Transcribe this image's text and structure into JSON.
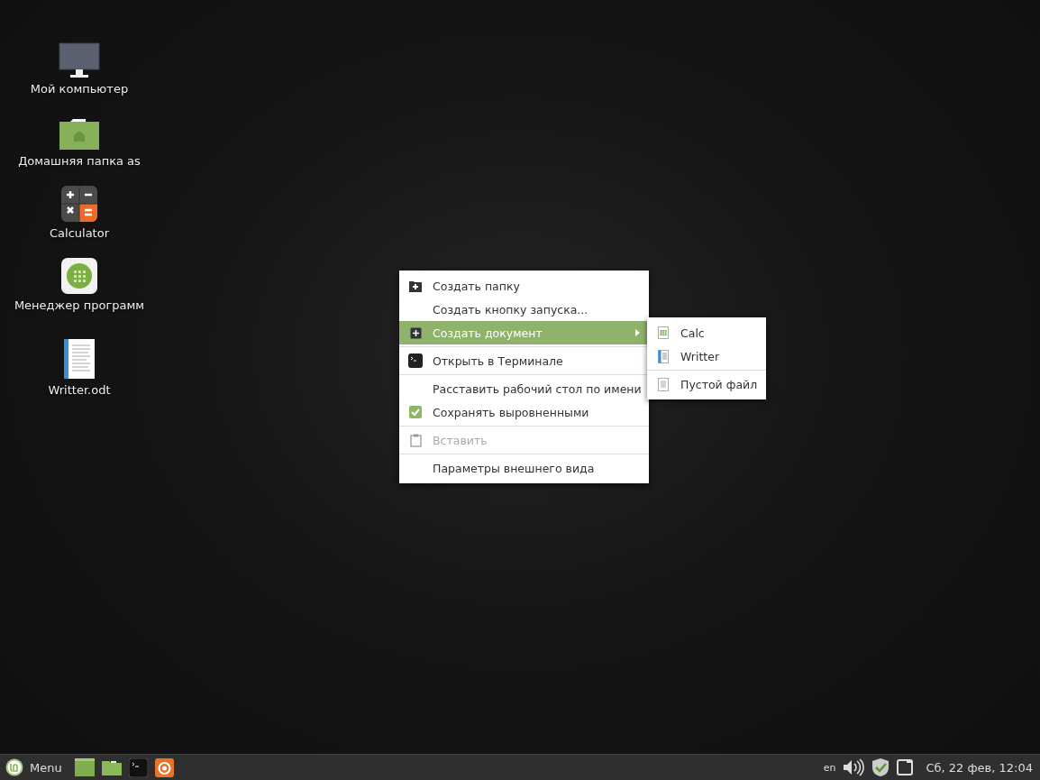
{
  "desktop_icons": [
    {
      "label": "Мой компьютер",
      "kind": "computer"
    },
    {
      "label": "Домашняя папка as",
      "kind": "home-folder"
    },
    {
      "label": "Calculator",
      "kind": "calculator"
    },
    {
      "label": "Менеджер программ",
      "kind": "software-manager"
    },
    {
      "label": "Writter.odt",
      "kind": "document"
    }
  ],
  "context_menu": {
    "items": [
      {
        "kind": "new-folder",
        "label": "Создать папку",
        "selected": false,
        "disabled": false
      },
      {
        "kind": "plain",
        "label": "Создать кнопку запуска...",
        "selected": false,
        "disabled": false
      },
      {
        "kind": "submenu",
        "label": "Создать документ",
        "selected": true,
        "disabled": false
      },
      {
        "kind": "separator"
      },
      {
        "kind": "terminal",
        "label": "Открыть в Терминале",
        "selected": false,
        "disabled": false
      },
      {
        "kind": "separator"
      },
      {
        "kind": "plain",
        "label": "Расставить рабочий стол по имени",
        "selected": false,
        "disabled": false
      },
      {
        "kind": "check",
        "label": "Сохранять выровненными",
        "checked": true,
        "selected": false,
        "disabled": false
      },
      {
        "kind": "separator"
      },
      {
        "kind": "paste",
        "label": "Вставить",
        "selected": false,
        "disabled": true
      },
      {
        "kind": "separator"
      },
      {
        "kind": "plain",
        "label": "Параметры внешнего вида",
        "selected": false,
        "disabled": false
      }
    ]
  },
  "submenu": {
    "items": [
      {
        "kind": "spreadsheet",
        "label": "Calc",
        "selected": false
      },
      {
        "kind": "text-document",
        "label": "Writter",
        "selected": false
      },
      {
        "kind": "separator"
      },
      {
        "kind": "blank-file",
        "label": "Пустой файл",
        "selected": false
      }
    ]
  },
  "panel": {
    "menu_label": "Menu",
    "launchers": [
      {
        "kind": "window"
      },
      {
        "kind": "folder"
      },
      {
        "kind": "terminal"
      },
      {
        "kind": "browser"
      }
    ],
    "keyboard_layout": "en",
    "clock": "Сб, 22 фев, 12:04"
  }
}
